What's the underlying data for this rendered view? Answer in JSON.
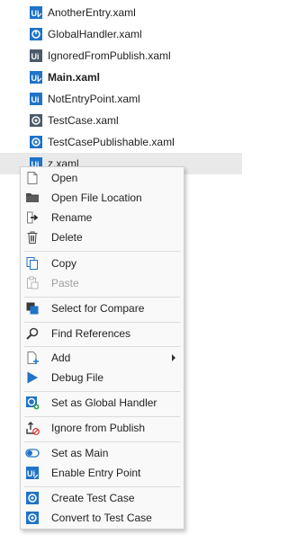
{
  "files": [
    {
      "name": "AnotherEntry.xaml",
      "icon": "uipath-entry-icon",
      "bold": false
    },
    {
      "name": "GlobalHandler.xaml",
      "icon": "global-handler-icon",
      "bold": false
    },
    {
      "name": "IgnoredFromPublish.xaml",
      "icon": "uipath-ignored-icon",
      "bold": false
    },
    {
      "name": "Main.xaml",
      "icon": "uipath-main-icon",
      "bold": true
    },
    {
      "name": "NotEntryPoint.xaml",
      "icon": "uipath-file-icon",
      "bold": false
    },
    {
      "name": "TestCase.xaml",
      "icon": "test-case-icon",
      "bold": false
    },
    {
      "name": "TestCasePublishable.xaml",
      "icon": "test-case-publishable-icon",
      "bold": false
    },
    {
      "name": "z.xaml",
      "icon": "uipath-file-icon",
      "bold": false,
      "selected": true
    }
  ],
  "menu": {
    "open": "Open",
    "open_file_location": "Open File Location",
    "rename": "Rename",
    "delete": "Delete",
    "copy": "Copy",
    "paste": "Paste",
    "select_for_compare": "Select for Compare",
    "find_references": "Find References",
    "add": "Add",
    "debug_file": "Debug File",
    "set_global_handler": "Set as Global Handler",
    "ignore_from_publish": "Ignore from Publish",
    "set_as_main": "Set as Main",
    "enable_entry_point": "Enable Entry Point",
    "create_test_case": "Create Test Case",
    "convert_to_test_case": "Convert to Test Case"
  },
  "colors": {
    "accent_blue": "#1f73c8",
    "selection_bg": "#e9e9e9",
    "menu_bg": "#f9f9f9",
    "disabled_text": "#a0a0a0"
  }
}
